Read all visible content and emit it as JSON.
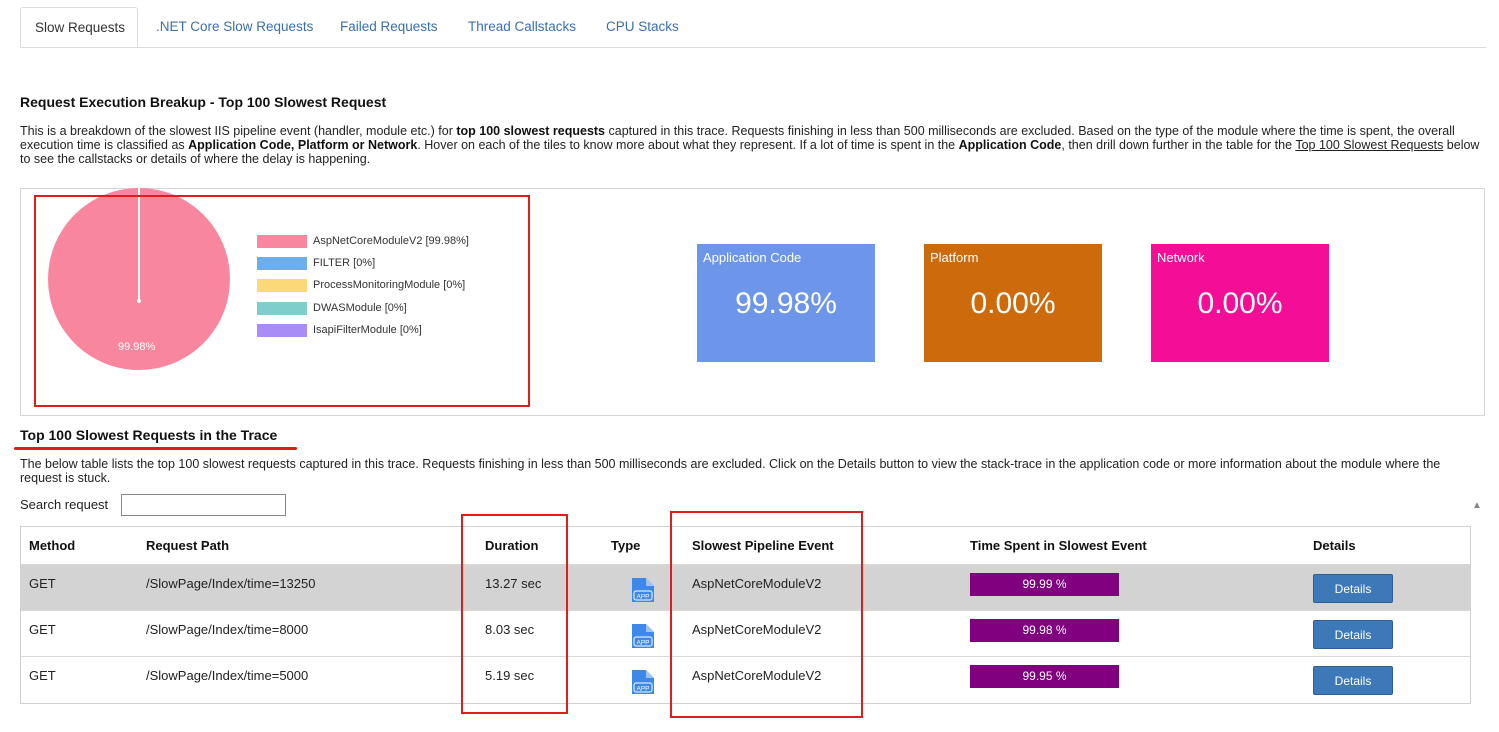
{
  "tabs": [
    {
      "label": "Slow Requests",
      "active": true
    },
    {
      "label": ".NET Core Slow Requests",
      "active": false
    },
    {
      "label": "Failed Requests",
      "active": false
    },
    {
      "label": "Thread Callstacks",
      "active": false
    },
    {
      "label": "CPU Stacks",
      "active": false
    }
  ],
  "breakup": {
    "title": "Request Execution Breakup - Top 100 Slowest Request",
    "desc": {
      "p1": "This is a breakdown of the slowest IIS pipeline event (handler, module etc.) for ",
      "b1": "top 100 slowest requests",
      "p2": " captured in this trace. Requests finishing in less than 500 milliseconds are excluded. Based on the type of the module where the time is spent, the overall execution time is classified as ",
      "b2": "Application Code, Platform or Network",
      "p3": ". Hover on each of the tiles to know more about what they represent. If a lot of time is spent in the ",
      "b3": "Application Code",
      "p4": ", then drill down further in the table for the ",
      "link": "Top 100 Slowest Requests",
      "p5": " below to see the callstacks or details of where the delay is happening."
    }
  },
  "chart_data": {
    "type": "pie",
    "categories": [
      "AspNetCoreModuleV2",
      "FILTER",
      "ProcessMonitoringModule",
      "DWASModule",
      "IsapiFilterModule"
    ],
    "values": [
      99.98,
      0,
      0,
      0,
      0
    ],
    "legend": [
      {
        "label": "AspNetCoreModuleV2 [99.98%]",
        "color": "#f7869e"
      },
      {
        "label": "FILTER [0%]",
        "color": "#6caeea"
      },
      {
        "label": "ProcessMonitoringModule [0%]",
        "color": "#fbd878"
      },
      {
        "label": "DWASModule [0%]",
        "color": "#7ecfcc"
      },
      {
        "label": "IsapiFilterModule [0%]",
        "color": "#a98cf5"
      }
    ],
    "slice_label": "99.98%",
    "legend_position": "right"
  },
  "tiles": [
    {
      "label": "Application Code",
      "value": "99.98%",
      "color": "#6d95ea"
    },
    {
      "label": "Platform",
      "value": "0.00%",
      "color": "#cc6a0c"
    },
    {
      "label": "Network",
      "value": "0.00%",
      "color": "#f40d97"
    }
  ],
  "slowest": {
    "title": "Top 100 Slowest Requests in the Trace",
    "desc": "The below table lists the top 100 slowest requests captured in this trace. Requests finishing in less than 500 milliseconds are excluded. Click on the Details button to view the stack-trace in the application code or more information about the module where the request is stuck.",
    "search_label": "Search request",
    "search_value": "",
    "columns": [
      "Method",
      "Request Path",
      "Duration",
      "Type",
      "Slowest Pipeline Event",
      "Time Spent in Slowest Event",
      "Details"
    ],
    "rows": [
      {
        "method": "GET",
        "path": "/SlowPage/Index/time=13250",
        "duration": "13.27 sec",
        "type_icon": "app-file-icon",
        "event": "AspNetCoreModuleV2",
        "time_spent": "99.99 %",
        "details": "Details"
      },
      {
        "method": "GET",
        "path": "/SlowPage/Index/time=8000",
        "duration": "8.03 sec",
        "type_icon": "app-file-icon",
        "event": "AspNetCoreModuleV2",
        "time_spent": "99.98 %",
        "details": "Details"
      },
      {
        "method": "GET",
        "path": "/SlowPage/Index/time=5000",
        "duration": "5.19 sec",
        "type_icon": "app-file-icon",
        "event": "AspNetCoreModuleV2",
        "time_spent": "99.95 %",
        "details": "Details"
      }
    ]
  },
  "colors": {
    "accent_link": "#3a6fb0",
    "highlight_red": "#e31b1b",
    "bar_purple": "#800080",
    "button_blue": "#3d78b8",
    "row_shade": "#d3d3d3"
  },
  "icons": {
    "scroll_up": "▲",
    "type_icon_text": "APP"
  }
}
